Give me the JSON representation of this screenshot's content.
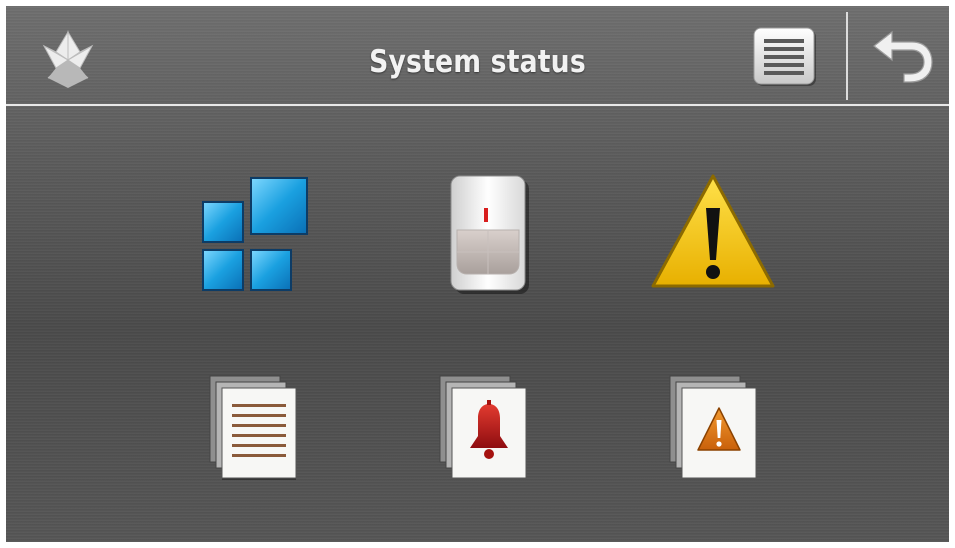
{
  "header": {
    "title": "System status"
  },
  "icons": {
    "logo": "satel-logo-icon",
    "menu": "menu-list-icon",
    "back": "back-arrow-icon",
    "partitions": "partitions-grid-icon",
    "zones": "motion-detector-icon",
    "troubles": "warning-triangle-icon",
    "event_log": "event-log-icon",
    "alarms_log": "alarm-bell-log-icon",
    "troubles_log": "trouble-log-icon"
  },
  "colors": {
    "accent_blue": "#1aa0e0",
    "warning_yellow": "#f2c300",
    "alarm_red": "#c0161c",
    "log_orange": "#e07a10"
  }
}
